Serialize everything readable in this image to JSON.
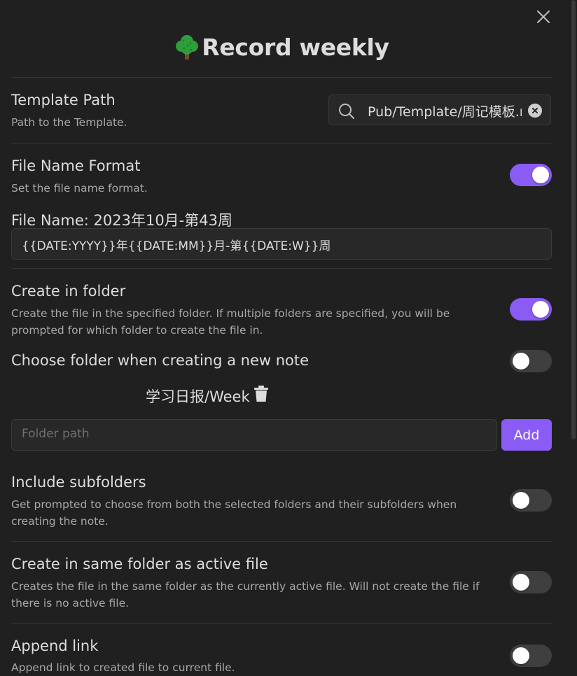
{
  "modal": {
    "title": "Record weekly"
  },
  "settings": {
    "template_path": {
      "label": "Template Path",
      "description": "Path to the Template.",
      "value": "Pub/Template/周记模板.md"
    },
    "file_name_format": {
      "label": "File Name Format",
      "description": "Set the file name format.",
      "enabled": true,
      "preview": "File Name: 2023年10月-第43周",
      "value": "{{DATE:YYYY}}年{{DATE:MM}}月-第{{DATE:W}}周"
    },
    "create_in_folder": {
      "label": "Create in folder",
      "description": "Create the file in the specified folder. If multiple folders are specified, you will be prompted for which folder to create the file in.",
      "enabled": true
    },
    "choose_folder": {
      "label": "Choose folder when creating a new note",
      "enabled": false
    },
    "folders": [
      "学习日报/Week"
    ],
    "folder_input": {
      "placeholder": "Folder path",
      "add_label": "Add"
    },
    "include_subfolders": {
      "label": "Include subfolders",
      "description": "Get prompted to choose from both the selected folders and their subfolders when creating the note.",
      "enabled": false
    },
    "same_folder": {
      "label": "Create in same folder as active file",
      "description": "Creates the file in the same folder as the currently active file. Will not create the file if there is no active file.",
      "enabled": false
    },
    "append_link": {
      "label": "Append link",
      "description": "Append link to created file to current file.",
      "enabled": false
    }
  },
  "icons": {
    "close": "close-icon",
    "tree": "tree-emoji-icon",
    "search": "search-icon",
    "clear": "clear-circle-icon",
    "trash": "trash-icon"
  },
  "colors": {
    "accent": "#8a5cf5",
    "background": "#202020",
    "toggle_off": "#3f3f3f"
  }
}
